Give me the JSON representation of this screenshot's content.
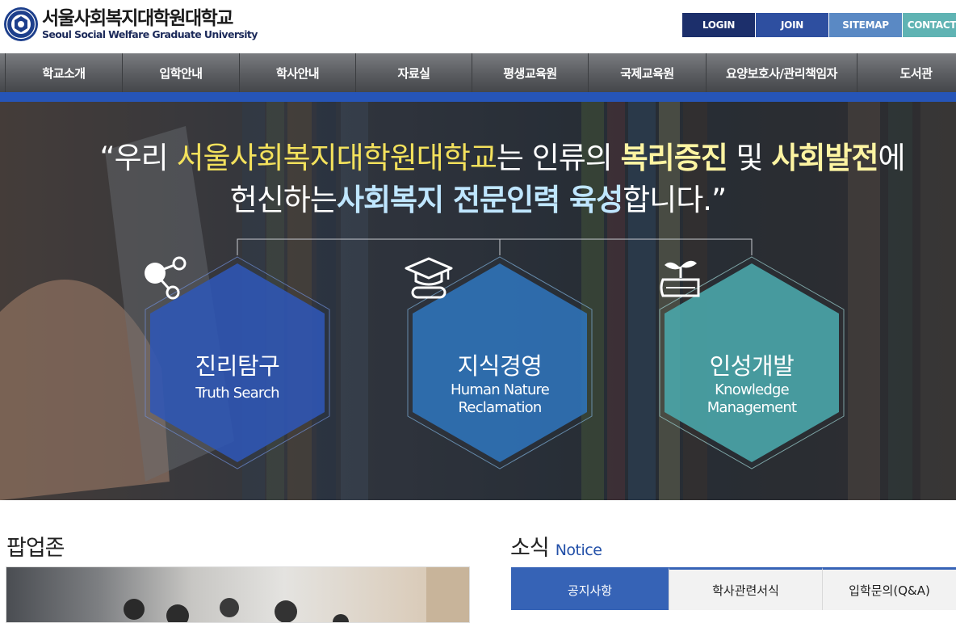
{
  "header": {
    "logo_kr": "서울사회복지대학원대학교",
    "logo_en": "Seoul Social Welfare Graduate University",
    "util": [
      {
        "label": "LOGIN",
        "color": "#1c2f6b"
      },
      {
        "label": "JOIN",
        "color": "#2e4fa0"
      },
      {
        "label": "SITEMAP",
        "color": "#5a89c4"
      },
      {
        "label": "CONTACT",
        "color": "#5fb3b3"
      }
    ]
  },
  "gnb": {
    "items": [
      "학교소개",
      "입학안내",
      "학사안내",
      "자료실",
      "평생교육원",
      "국제교육원",
      "요양보호사/관리책임자",
      "도서관"
    ],
    "bar_color": "#2655b8"
  },
  "hero": {
    "slogan": {
      "l1_a": "“우리 ",
      "l1_b": "서울사회복지대학원대학교",
      "l1_c": "는 인류의 ",
      "l1_d": "복리증진",
      "l1_e": " 및 ",
      "l1_f": "사회발전",
      "l1_g": "에",
      "l2_a": "헌신하는",
      "l2_b": "사회복지 전문인력 육성",
      "l2_c": "합니다.”"
    },
    "values": [
      {
        "title": "진리탐구",
        "sub1": "Truth Search",
        "sub2": "",
        "icon": "share-nodes-icon",
        "color": "#2f56b6"
      },
      {
        "title": "지식경영",
        "sub1": "Human Nature",
        "sub2": "Reclamation",
        "icon": "graduation-cap-icon",
        "color": "#2f74bb"
      },
      {
        "title": "인성개발",
        "sub1": "Knowledge",
        "sub2": "Management",
        "icon": "sprout-book-icon",
        "color": "#4aa6aa"
      }
    ]
  },
  "popup": {
    "title": "팝업존"
  },
  "news": {
    "title": "소식",
    "title_en": "Notice",
    "tabs": [
      "공지사항",
      "학사관련서식",
      "입학문의(Q&A)"
    ],
    "active_tab": 0
  }
}
